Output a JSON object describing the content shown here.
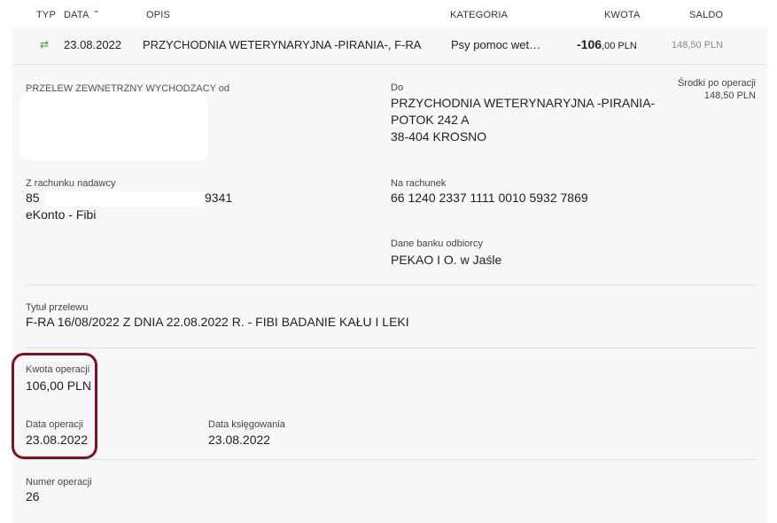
{
  "header": {
    "typ": "TYP",
    "data": "DATA",
    "sort_arrow": "^",
    "opis": "OPIS",
    "kategoria": "KATEGORIA",
    "kwota": "KWOTA",
    "saldo": "SALDO"
  },
  "transaction": {
    "type_icon": "⇄",
    "date": "23.08.2022",
    "description": "PRZYCHODNIA WETERYNARYJNA -PIRANIA-, F-RA",
    "category": "Psy pomoc wet…",
    "amount_main": "-106",
    "amount_cents": ",00 PLN",
    "balance": "148,50 PLN"
  },
  "details": {
    "transfer_type": "PRZELEW ZEWNETRZNY WYCHODZACY od",
    "to_label": "Do",
    "to_line1": "PRZYCHODNIA WETERYNARYJNA -PIRANIA-",
    "to_line2": "POTOK 242 A",
    "to_line3": "38-404 KROSNO",
    "funds_after_label": "Środki po operacji",
    "funds_after_value": "148,50 PLN",
    "from_account_label": "Z rachunku nadawcy",
    "from_account_start": "85",
    "from_account_end": "9341",
    "from_account_name": "eKonto - Fibi",
    "to_account_label": "Na rachunek",
    "to_account_value": "66 1240 2337 1111 0010 5932 7869",
    "bank_label": "Dane banku odbiorcy",
    "bank_value": "PEKAO I O. w Jaśle",
    "title_label": "Tytuł przelewu",
    "title_value": "F-RA 16/08/2022 Z DNIA 22.08.2022 R. - FIBI BADANIE KAŁU I LEKI",
    "op_amount_label": "Kwota operacji",
    "op_amount_value": "106,00 PLN",
    "op_date_label": "Data operacji",
    "op_date_value": "23.08.2022",
    "booking_date_label": "Data księgowania",
    "booking_date_value": "23.08.2022",
    "op_number_label": "Numer operacji",
    "op_number_value": "26"
  },
  "colors": {
    "accent": "#c8102e",
    "highlight_border": "#7a1424",
    "transfer_icon": "#36a04a",
    "panel_bg": "#f7f7f7"
  }
}
